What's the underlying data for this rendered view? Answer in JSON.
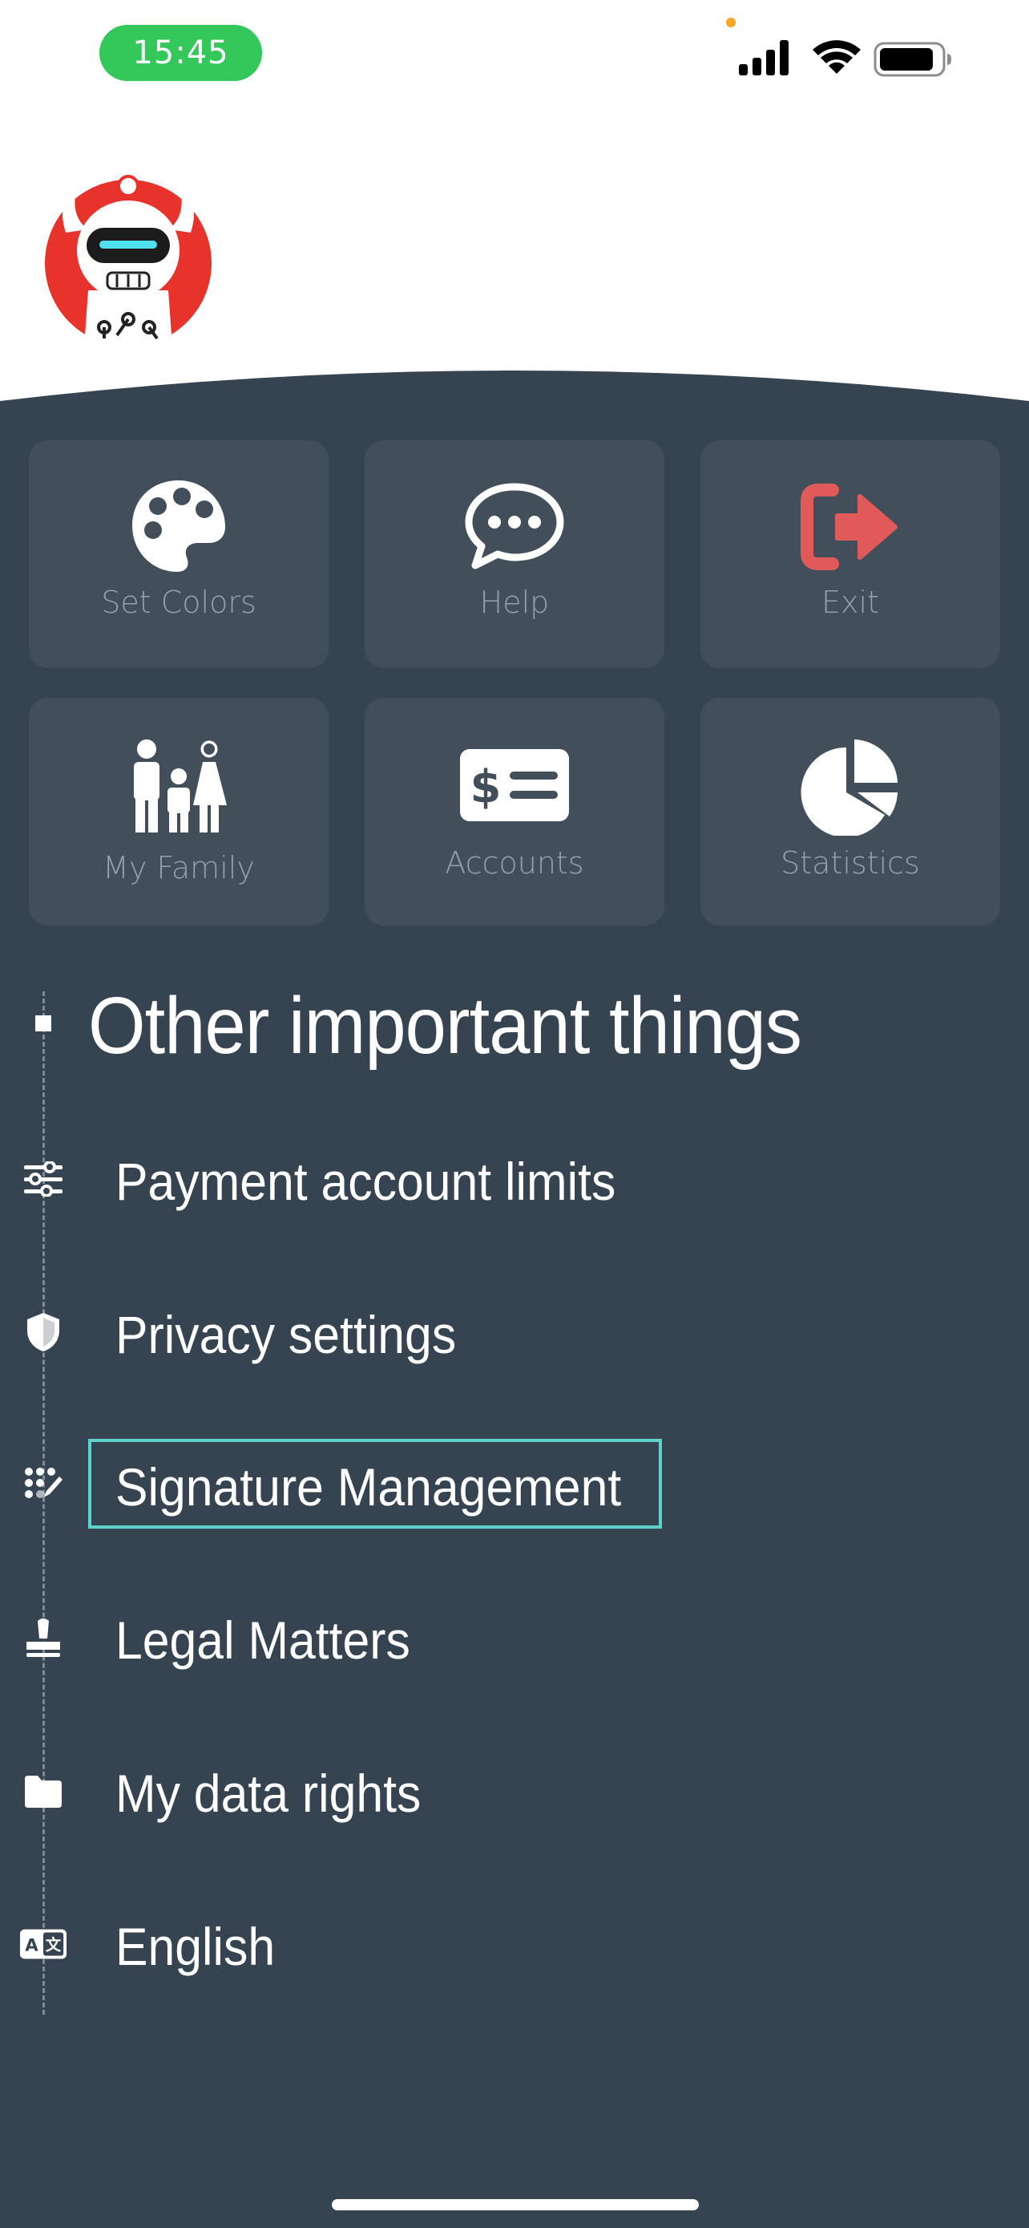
{
  "status_bar": {
    "time": "15:45"
  },
  "tiles": [
    {
      "id": "set-colors",
      "label": "Set Colors",
      "icon": "palette-icon"
    },
    {
      "id": "help",
      "label": "Help",
      "icon": "chat-bubble-icon"
    },
    {
      "id": "exit",
      "label": "Exit",
      "icon": "sign-out-icon",
      "accent": "#e05a5a"
    },
    {
      "id": "my-family",
      "label": "My Family",
      "icon": "family-icon"
    },
    {
      "id": "accounts",
      "label": "Accounts",
      "icon": "money-check-icon"
    },
    {
      "id": "statistics",
      "label": "Statistics",
      "icon": "pie-chart-icon"
    }
  ],
  "section": {
    "title": "Other important things"
  },
  "menu": [
    {
      "label": "Payment account limits",
      "icon": "sliders-icon"
    },
    {
      "label": "Privacy settings",
      "icon": "shield-icon"
    },
    {
      "label": "Signature Management",
      "icon": "signature-icon",
      "focused": true
    },
    {
      "label": "Legal Matters",
      "icon": "stamp-icon"
    },
    {
      "label": "My data rights",
      "icon": "folder-icon"
    },
    {
      "label": "English",
      "icon": "language-icon"
    }
  ],
  "colors": {
    "panel_bg": "#364451",
    "tile_bg": "#424f5b",
    "tile_label": "#96a0aa",
    "focus_outline": "#5fd3c9",
    "time_pill": "#34c759",
    "avatar_red": "#e8322c"
  }
}
